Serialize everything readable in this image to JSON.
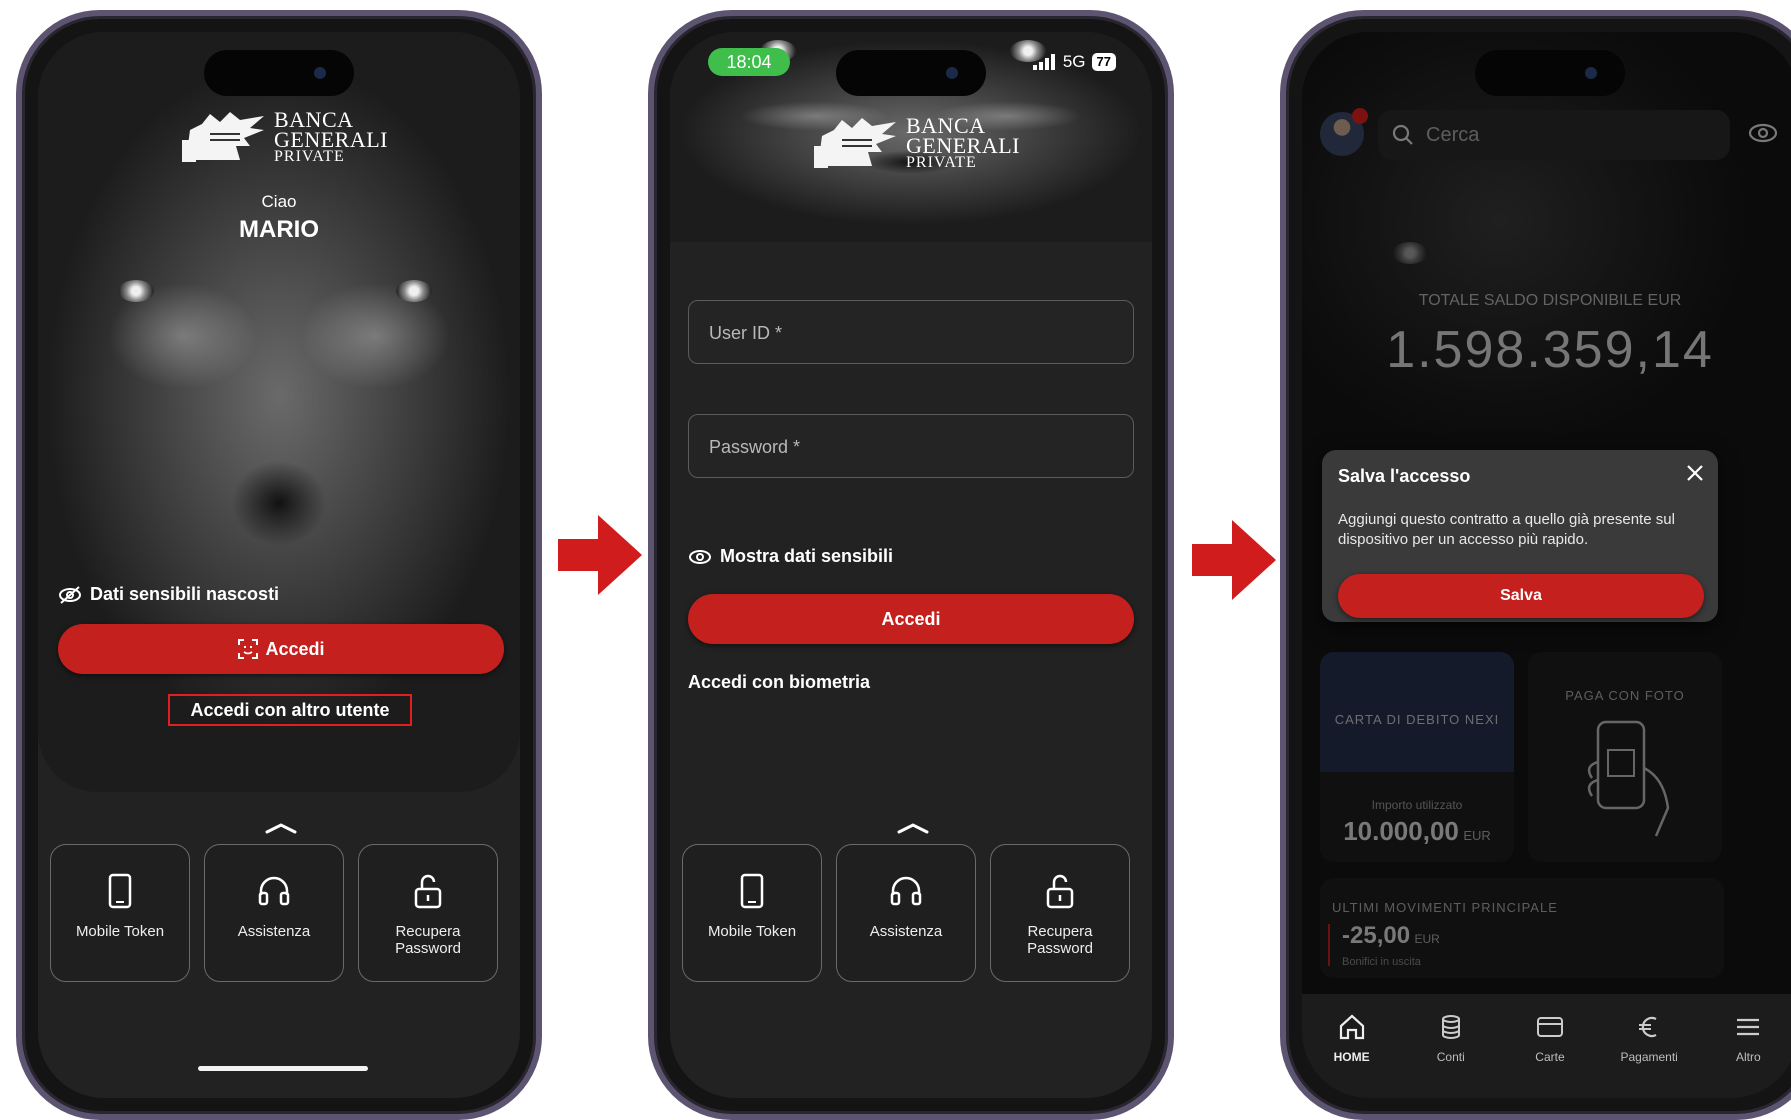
{
  "screen1": {
    "logo": {
      "line1": "BANCA",
      "line2": "GENERALI",
      "line3": "PRIVATE"
    },
    "greeting": "Ciao",
    "user_name": "MARIO",
    "hidden_data_label": "Dati sensibili nascosti",
    "login_button": "Accedi",
    "other_user_link": "Accedi con altro utente",
    "tiles": [
      {
        "label": "Mobile Token",
        "icon": "phone-icon"
      },
      {
        "label": "Assistenza",
        "icon": "headset-icon"
      },
      {
        "label": "Recupera\nPassword",
        "icon": "unlock-icon"
      }
    ]
  },
  "screen2": {
    "status_time": "18:04",
    "status_network": "5G",
    "status_battery": "77",
    "logo": {
      "line1": "BANCA",
      "line2": "GENERALI",
      "line3": "PRIVATE"
    },
    "userid_placeholder": "User ID *",
    "password_placeholder": "Password *",
    "show_data_label": "Mostra dati sensibili",
    "login_button": "Accedi",
    "biometric_link": "Accedi con biometria",
    "tiles": [
      {
        "label": "Mobile Token",
        "icon": "phone-icon"
      },
      {
        "label": "Assistenza",
        "icon": "headset-icon"
      },
      {
        "label": "Recupera\nPassword",
        "icon": "unlock-icon"
      }
    ]
  },
  "screen3": {
    "search_placeholder": "Cerca",
    "balance_label": "TOTALE SALDO DISPONIBILE EUR",
    "balance_value": "1.598.359,14",
    "dialog": {
      "title": "Salva l'accesso",
      "body": "Aggiungi questo contratto a quello già presente sul dispositivo per un accesso più rapido.",
      "button": "Salva"
    },
    "card_debit": {
      "title": "CARTA DI DEBITO NEXI",
      "used_label": "Importo utilizzato",
      "amount": "10.000,00",
      "currency": "EUR"
    },
    "card_photo": {
      "title": "PAGA CON FOTO"
    },
    "movements": {
      "title": "ULTIMI MOVIMENTI PRINCIPALE",
      "amount": "-25,00",
      "currency": "EUR",
      "desc": "Bonifici in uscita"
    },
    "nav": [
      {
        "label": "HOME",
        "icon": "home-icon"
      },
      {
        "label": "Conti",
        "icon": "database-icon"
      },
      {
        "label": "Carte",
        "icon": "card-icon"
      },
      {
        "label": "Pagamenti",
        "icon": "euro-icon"
      },
      {
        "label": "Altro",
        "icon": "menu-icon"
      }
    ]
  },
  "colors": {
    "accent_red": "#c4201e",
    "arrow_red": "#d01c1c",
    "frame": "#5c5470"
  }
}
